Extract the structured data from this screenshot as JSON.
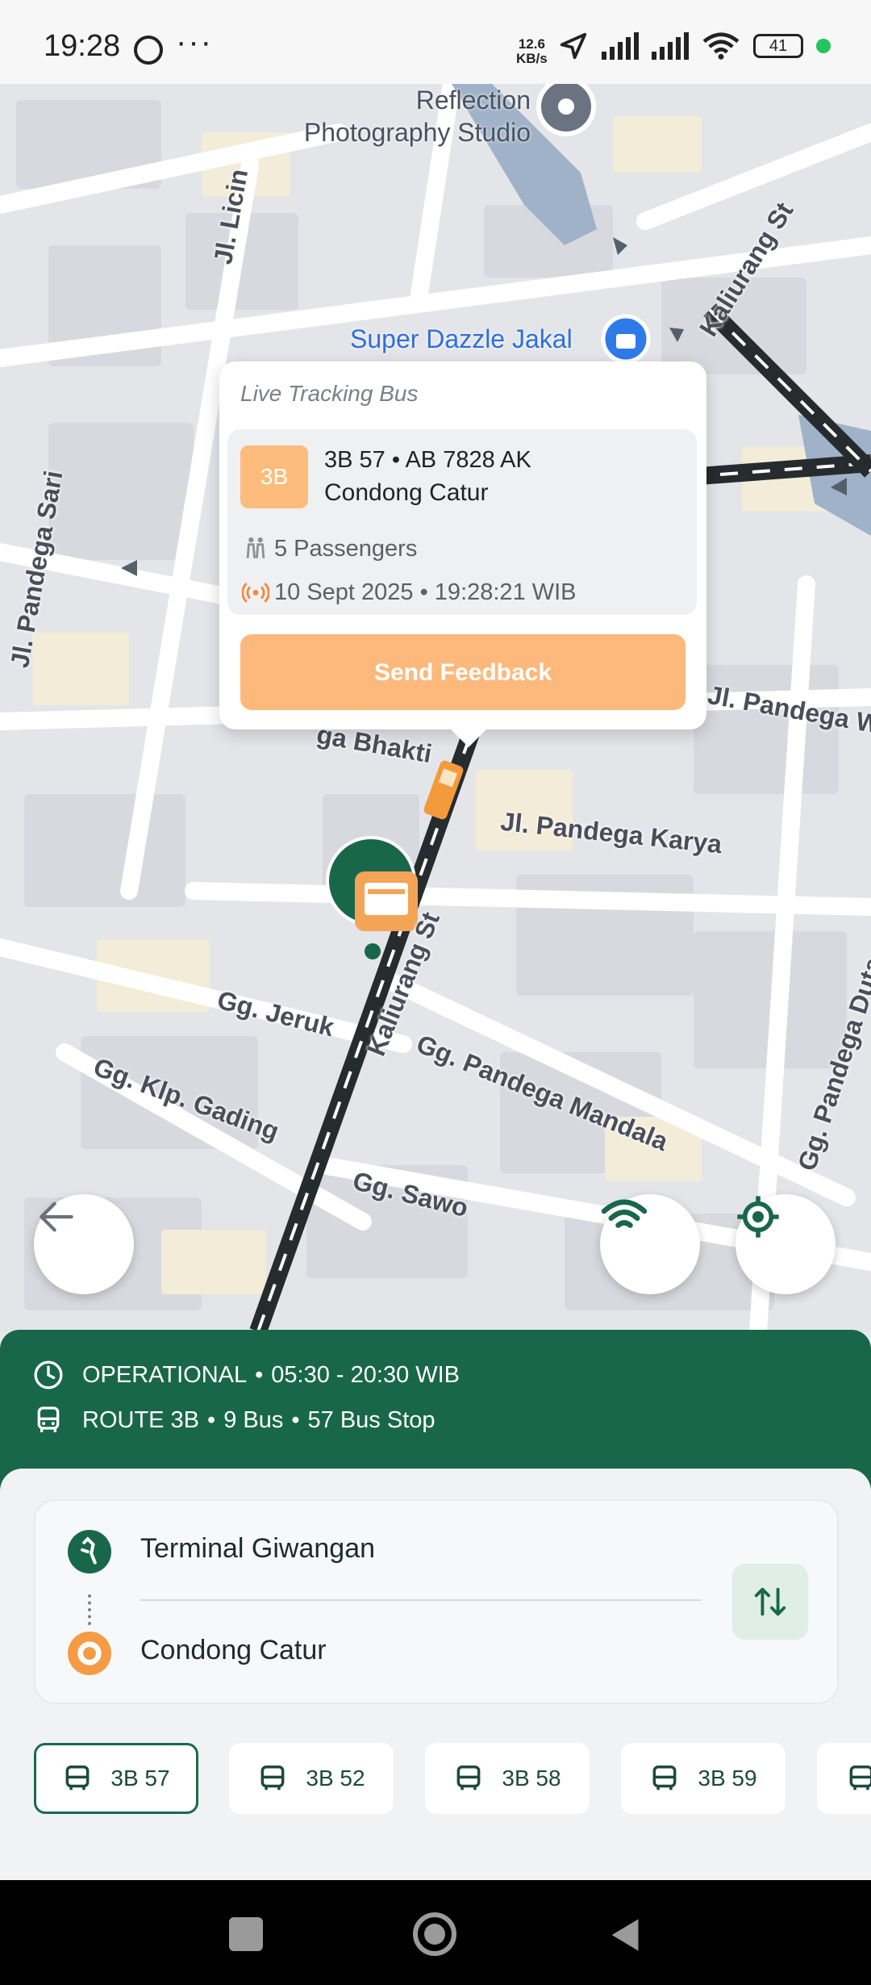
{
  "status_bar": {
    "time": "19:28",
    "speed_value": "12.6",
    "speed_unit": "KB/s",
    "battery": "41",
    "icons": [
      "whatsapp-icon",
      "more-icon",
      "location-arrow-icon",
      "signal-icon",
      "signal-icon",
      "wifi-icon",
      "battery-icon"
    ]
  },
  "map": {
    "poi": {
      "reflection": "Reflection\nPhotography Studio",
      "super_dazzle": "Super Dazzle Jakal"
    },
    "streets": {
      "licin": "Jl. Licin",
      "kaliurang_top": "Kaliurang St",
      "pandega_sari": "Jl. Pandega Sari",
      "pandega_bhakti": "ga Bhakti",
      "pandega_wre": "Jl. Pandega Wre",
      "pandega_karya": "Jl. Pandega Karya",
      "kaliurang_mid": "Kaliurang St",
      "jeruk": "Gg. Jeruk",
      "klp_gading": "Gg. Klp. Gading",
      "pandega_mandala": "Gg. Pandega Mandala",
      "sawo": "Gg. Sawo",
      "pandega_duta": "Gg. Pandega Duta"
    }
  },
  "popup": {
    "title": "Live Tracking Bus",
    "route_badge": "3B",
    "bus_line": "3B 57 • AB 7828 AK",
    "destination": "Condong Catur",
    "passengers": "5 Passengers",
    "timestamp": "10 Sept 2025 • 19:28:21 WIB",
    "feedback_button": "Send Feedback"
  },
  "info": {
    "status": "OPERATIONAL",
    "hours": "05:30 - 20:30 WIB",
    "route": "ROUTE 3B",
    "bus_count": "9 Bus",
    "stop_count": "57 Bus Stop"
  },
  "trip": {
    "origin": "Terminal Giwangan",
    "destination": "Condong Catur"
  },
  "buses": [
    {
      "label": "3B 57",
      "active": true
    },
    {
      "label": "3B 52",
      "active": false
    },
    {
      "label": "3B 58",
      "active": false
    },
    {
      "label": "3B 59",
      "active": false
    }
  ],
  "colors": {
    "primary_green": "#19674a",
    "accent_orange": "#fdb97c",
    "route_line": "#262b2e"
  }
}
